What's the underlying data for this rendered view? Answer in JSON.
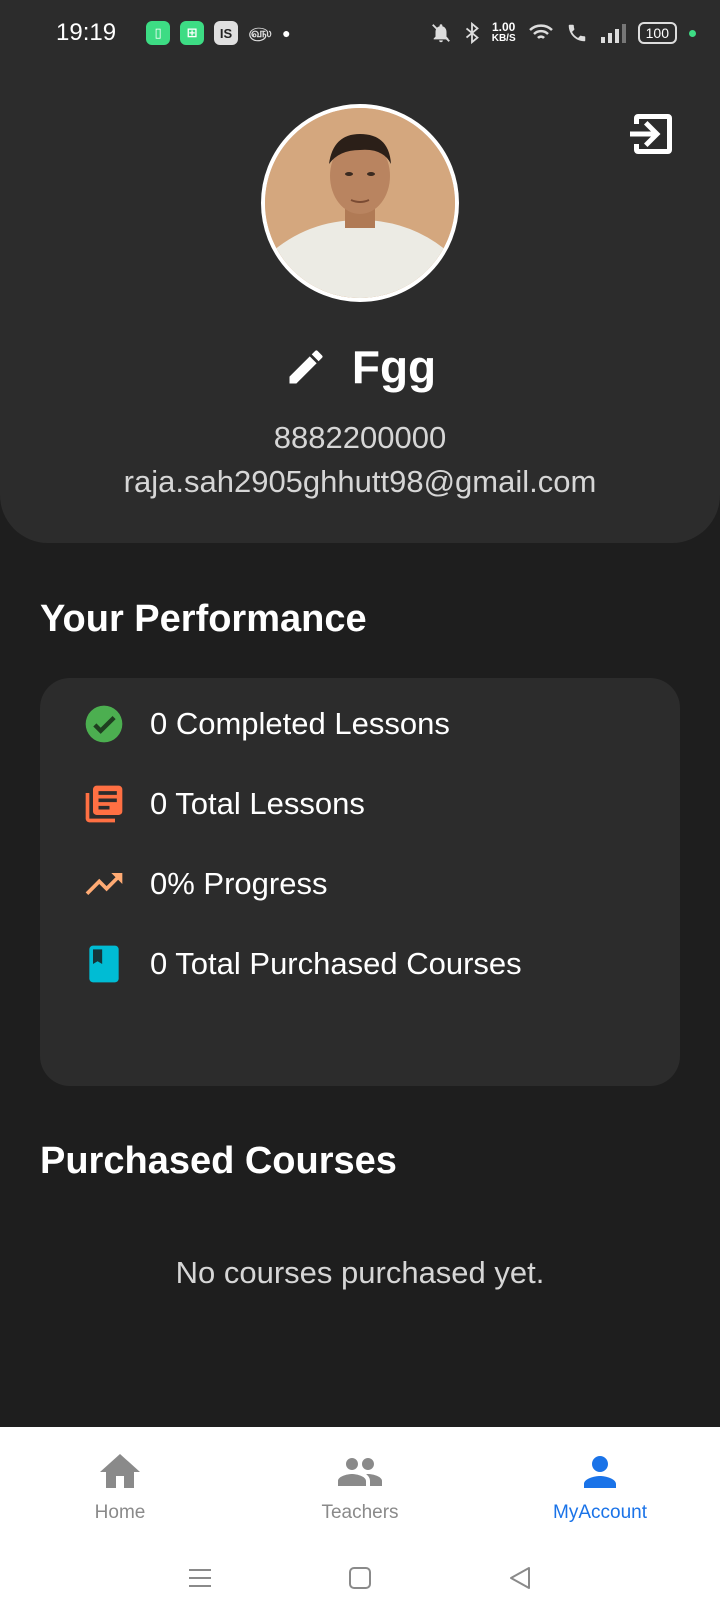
{
  "status_bar": {
    "time": "19:19",
    "speed_value": "1.00",
    "speed_unit": "KB/S",
    "battery": "100"
  },
  "profile": {
    "name": "Fgg",
    "phone": "8882200000",
    "email": "raja.sah2905ghhutt98@gmail.com"
  },
  "performance": {
    "title": "Your Performance",
    "stats": [
      {
        "label": "0 Completed Lessons",
        "icon": "check-circle-icon",
        "color": "#4caf50"
      },
      {
        "label": "0 Total Lessons",
        "icon": "library-books-icon",
        "color": "#ff7043"
      },
      {
        "label": "0% Progress",
        "icon": "trending-up-icon",
        "color": "#ffab74"
      },
      {
        "label": "0 Total Purchased Courses",
        "icon": "book-icon",
        "color": "#00bcd4"
      }
    ]
  },
  "purchased": {
    "title": "Purchased Courses",
    "empty_message": "No courses purchased yet."
  },
  "bottom_nav": {
    "items": [
      {
        "label": "Home",
        "icon": "home-icon"
      },
      {
        "label": "Teachers",
        "icon": "people-icon"
      },
      {
        "label": "MyAccount",
        "icon": "person-icon",
        "active": true
      }
    ]
  },
  "colors": {
    "background": "#1e1e1e",
    "card": "#2c2c2c",
    "accent": "#1a73e8"
  }
}
